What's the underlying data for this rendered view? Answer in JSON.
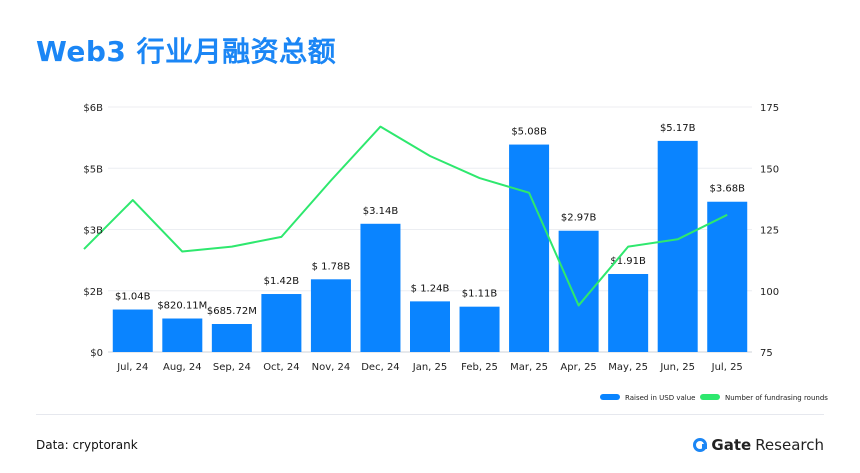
{
  "header": {
    "title": "Web3 行业月融资总额"
  },
  "footer": {
    "source": "Data: cryptorank",
    "brand_name": "Gate",
    "brand_suffix": "Research"
  },
  "colors": {
    "bar": "#0a84ff",
    "line": "#2ee86e",
    "title": "#1b86f5"
  },
  "chart_data": {
    "type": "bar",
    "categories": [
      "Jul, 24",
      "Aug, 24",
      "Sep, 24",
      "Oct, 24",
      "Nov, 24",
      "Dec, 24",
      "Jan, 25",
      "Feb, 25",
      "Mar, 25",
      "Apr, 25",
      "May, 25",
      "Jun, 25",
      "Jul, 25"
    ],
    "series": [
      {
        "name": "Raised in USD value",
        "type": "bar",
        "axis": "left",
        "values": [
          1.04,
          0.82011,
          0.68572,
          1.42,
          1.78,
          3.14,
          1.24,
          1.11,
          5.08,
          2.97,
          1.91,
          5.17,
          3.68
        ],
        "labels": [
          "$1.04B",
          "$820.11M",
          "$685.72M",
          "$1.42B",
          "$ 1.78B",
          "$3.14B",
          "$ 1.24B",
          "$1.11B",
          "$5.08B",
          "$2.97B",
          "$1.91B",
          "$5.17B",
          "$3.68B"
        ]
      },
      {
        "name": "Number of fundrasing rounds",
        "type": "line",
        "axis": "right",
        "values": [
          137,
          116,
          118,
          122,
          145,
          167,
          155,
          146,
          140,
          94,
          118,
          121,
          131
        ]
      }
    ],
    "y_left": {
      "ticks": [
        0,
        1.5,
        3,
        4.5,
        6
      ],
      "tick_labels": [
        "$0",
        "$2B",
        "$3B",
        "$5B",
        "$6B"
      ],
      "ylim": [
        0,
        6
      ]
    },
    "y_right": {
      "ticks": [
        75,
        100,
        125,
        150,
        175
      ],
      "tick_labels": [
        "75",
        "100",
        "125",
        "150",
        "175"
      ],
      "ylim": [
        75,
        175
      ]
    },
    "line_x_start_value": 117,
    "grid": true,
    "legend": "bottom-right"
  }
}
